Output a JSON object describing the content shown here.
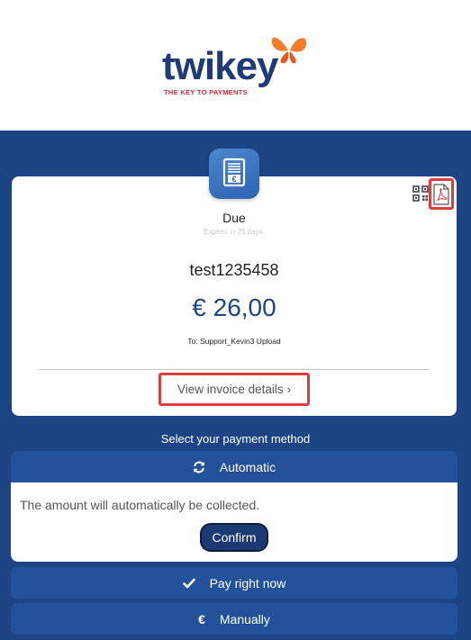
{
  "brand": {
    "name": "twikey",
    "tagline": "THE KEY TO PAYMENTS"
  },
  "invoice": {
    "status": "Due",
    "expires": "Expires in 25 days.",
    "reference": "test1235458",
    "amount": "€ 26,00",
    "recipient": "To: Support_Kevin3 Upload",
    "view_details": "View invoice details",
    "view_details_chevron": "›"
  },
  "payment": {
    "select_label": "Select your payment method",
    "methods": [
      {
        "label": "Automatic",
        "icon": "refresh-icon",
        "expanded": true,
        "description": "The amount will automatically be collected.",
        "action": "Confirm"
      },
      {
        "label": "Pay right now",
        "icon": "check-icon",
        "expanded": false
      },
      {
        "label": "Manually",
        "icon": "euro-icon",
        "icon_glyph": "€",
        "expanded": false
      }
    ]
  },
  "colors": {
    "brand_blue": "#1d4585",
    "method_blue": "#24529a",
    "highlight_red": "#e23b3b",
    "logo_red": "#d9242f",
    "butterfly_orange": "#f47b2a"
  }
}
